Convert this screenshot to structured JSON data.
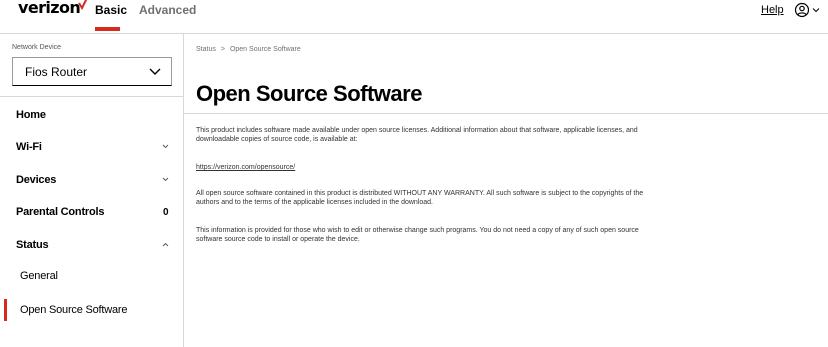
{
  "header": {
    "logo_text": "verizon",
    "tabs": [
      {
        "label": "Basic",
        "active": true
      },
      {
        "label": "Advanced",
        "active": false
      }
    ],
    "help_label": "Help",
    "accent_color": "#d52b1e"
  },
  "sidebar": {
    "device_label": "Network Device",
    "device_value": "Fios Router",
    "items": [
      {
        "label": "Home"
      },
      {
        "label": "Wi-Fi"
      },
      {
        "label": "Devices"
      },
      {
        "label": "Parental Controls",
        "count": "0"
      },
      {
        "label": "Status"
      }
    ],
    "sub_items": [
      {
        "label": "General"
      },
      {
        "label": "Open Source Software",
        "active": true
      }
    ]
  },
  "main": {
    "breadcrumb": [
      "Status",
      ">",
      "Open Source Software"
    ],
    "title": "Open Source Software",
    "paragraphs": [
      "This product includes software made available under open source licenses. Additional information about that software, applicable licenses, and downloadable copies of source code, is available at:",
      "All open source software contained in this product is distributed WITHOUT ANY WARRANTY. All such software is subject to the copyrights of the authors and to the terms of the applicable licenses included in the download.",
      "This information is provided for those who wish to edit or otherwise change such programs. You do not need a copy of any of such open source software source code to install or operate the device."
    ],
    "link": "https://verizon.com/opensource/"
  }
}
